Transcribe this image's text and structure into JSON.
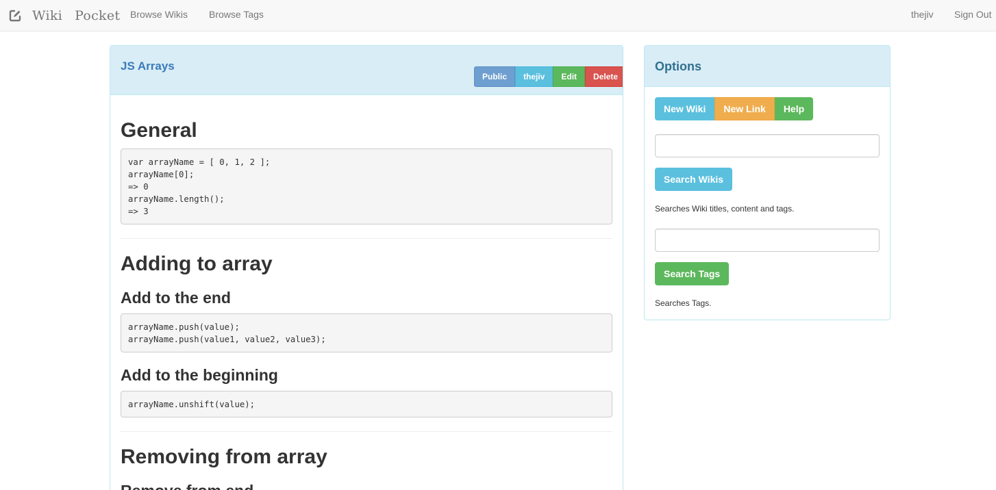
{
  "navbar": {
    "brand_icon": "edit-icon",
    "brand_word1": "Wiki",
    "brand_word2": "Pocket",
    "links": [
      "Browse Wikis",
      "Browse Tags"
    ],
    "user": "thejiv",
    "sign_out": "Sign Out"
  },
  "wiki": {
    "title": "JS Arrays",
    "buttons": {
      "visibility": "Public",
      "owner": "thejiv",
      "edit": "Edit",
      "delete": "Delete"
    },
    "content": {
      "h_general": "General",
      "code_general": "var arrayName = [ 0, 1, 2 ];\narrayName[0];\n=> 0\narrayName.length();\n=> 3",
      "h_adding": "Adding to array",
      "h_add_end": "Add to the end",
      "code_add_end": "arrayName.push(value);\narrayName.push(value1, value2, value3);",
      "h_add_begin": "Add to the beginning",
      "code_add_begin": "arrayName.unshift(value);",
      "h_removing": "Removing from array",
      "h_remove_end": "Remove from end"
    }
  },
  "options": {
    "title": "Options",
    "new_wiki": "New Wiki",
    "new_link": "New Link",
    "help": "Help",
    "wiki_search_value": "",
    "search_wikis": "Search Wikis",
    "wiki_search_help": "Searches Wiki titles, content and tags.",
    "tag_search_value": "",
    "search_tags": "Search Tags",
    "tag_search_help": "Searches Tags."
  },
  "colors": {
    "primary": "#6f9fd0",
    "info": "#5bc0de",
    "success": "#5cb85c",
    "warning": "#f0ad4e",
    "danger": "#d9534f",
    "panel_heading": "#d9edf7",
    "panel_title": "#31708f"
  }
}
